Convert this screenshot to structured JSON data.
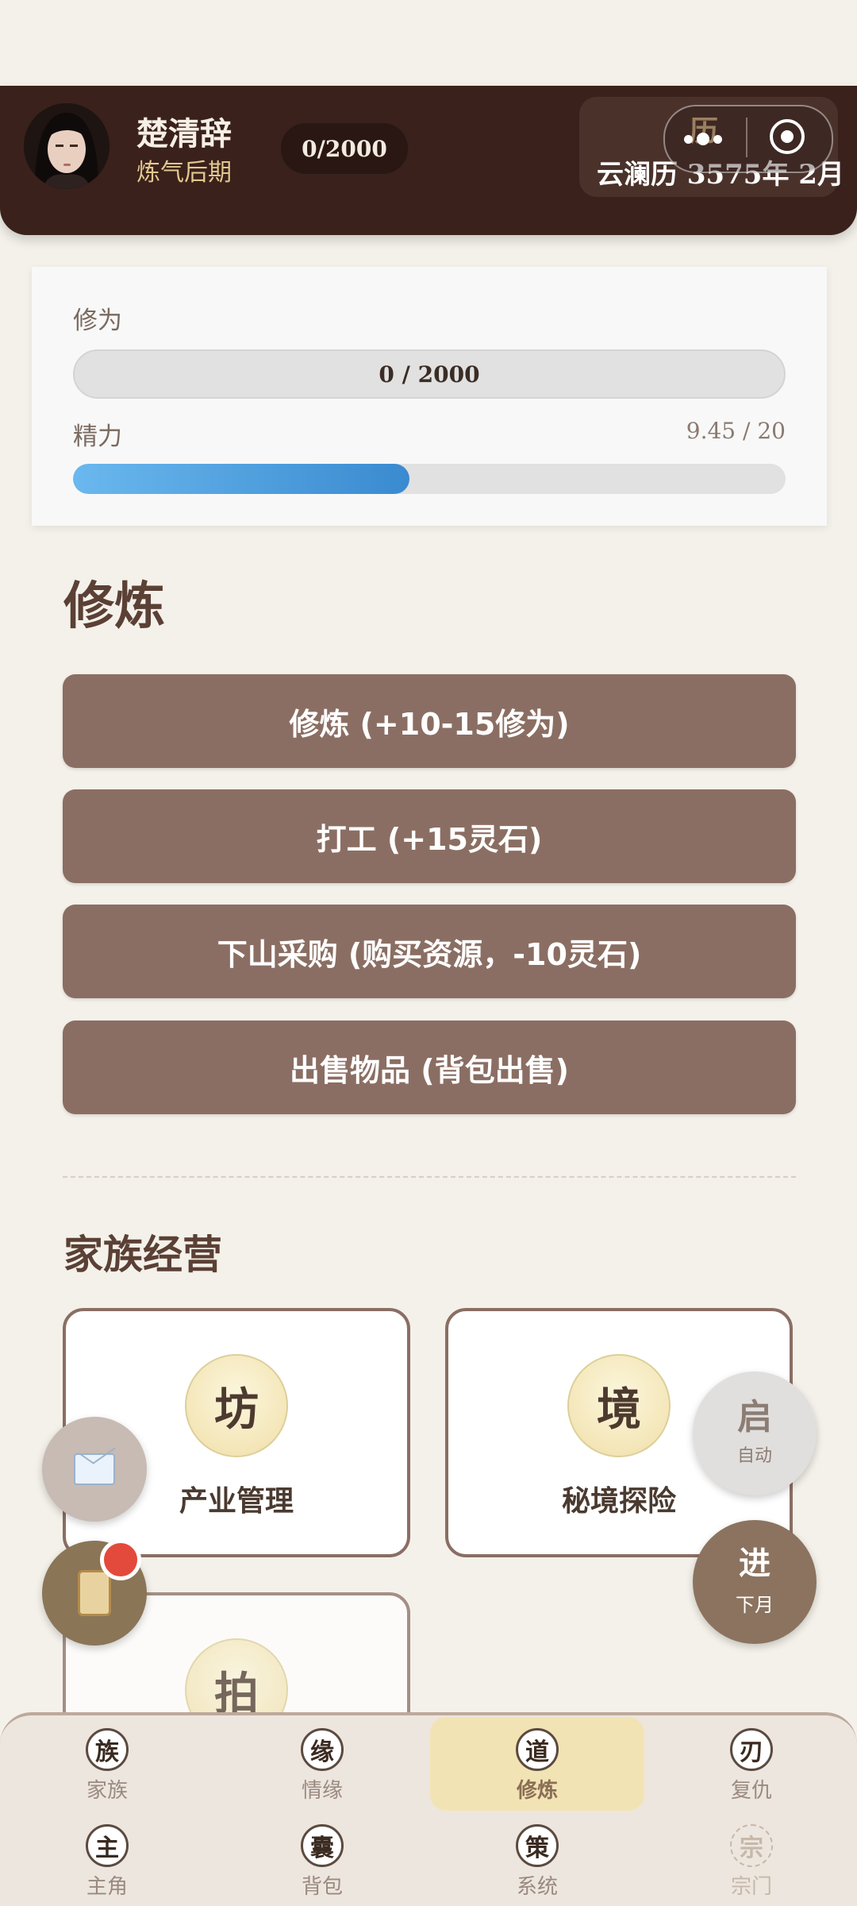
{
  "header": {
    "character_name": "楚清辞",
    "realm": "炼气后期",
    "cultivation_pill": "0/2000",
    "history_icon": "历",
    "calendar_date": "云澜历 3575年 2月"
  },
  "stats": {
    "cultivation_label": "修为",
    "cultivation_text": "0 / 2000",
    "energy_label": "精力",
    "energy_value": "9.45 / 20",
    "energy_fraction": 0.4725
  },
  "practice": {
    "title": "修炼",
    "buttons": [
      "修炼 (+10-15修为)",
      "打工 (+15灵石)",
      "下山采购 (购买资源，-10灵石)",
      "出售物品 (背包出售)"
    ]
  },
  "family": {
    "title": "家族经营",
    "cards": [
      {
        "icon_char": "坊",
        "label": "产业管理"
      },
      {
        "icon_char": "境",
        "label": "秘境探险"
      },
      {
        "icon_char": "拍",
        "label": ""
      }
    ]
  },
  "floating": {
    "auto_main": "启",
    "auto_sub": "自动",
    "next_main": "进",
    "next_sub": "下月",
    "mail_icon": "envelope-icon",
    "scroll_icon": "scroll-icon"
  },
  "bottom_nav": [
    {
      "char": "族",
      "label": "家族"
    },
    {
      "char": "缘",
      "label": "情缘"
    },
    {
      "char": "道",
      "label": "修炼",
      "active": true
    },
    {
      "char": "刃",
      "label": "复仇"
    },
    {
      "char": "主",
      "label": "主角"
    },
    {
      "char": "囊",
      "label": "背包"
    },
    {
      "char": "策",
      "label": "系统"
    },
    {
      "char": "宗",
      "label": "宗门",
      "disabled": true
    }
  ],
  "colors": {
    "header_bg": "#3a211b",
    "action_button": "#8b6e63",
    "energy_fill": "#3a8ad0",
    "nav_active": "#f2e3b4",
    "notification": "#e34a3c"
  }
}
